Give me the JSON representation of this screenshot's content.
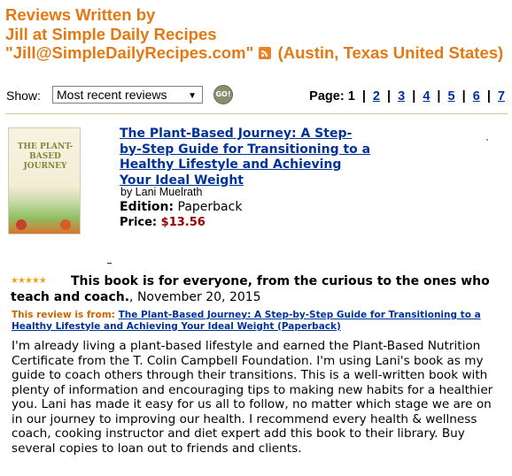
{
  "header": {
    "line1": "Reviews Written by",
    "line2": "Jill at Simple Daily Recipes",
    "email": "\"Jill@SimpleDailyRecipes.com\"",
    "rss_icon": "rss-icon",
    "location": "(Austin, Texas United States)"
  },
  "controls": {
    "show_label": "Show:",
    "sort_selected": "Most recent reviews",
    "go_label": "GO!"
  },
  "pagination": {
    "label": "Page:",
    "current": "1",
    "pages": [
      "2",
      "3",
      "4",
      "5",
      "6",
      "7"
    ],
    "separator": "|"
  },
  "product": {
    "cover_title": "THE PLANT-BASED JOURNEY",
    "title": "The Plant-Based Journey: A Step-by-Step Guide for Transitioning to a Healthy Lifestyle and Achieving Your Ideal Weight",
    "by": "by Lani Muelrath",
    "edition_label": "Edition:",
    "edition_value": "Paperback",
    "price_label": "Price:",
    "price_value": "$13.56"
  },
  "review": {
    "rating": 5,
    "rating_max": 5,
    "title": "This book is for everyone, from the curious to the ones who teach and coach.",
    "date": ", November 20, 2015",
    "from_label": "This review is from:",
    "from_link": "The Plant-Based Journey: A Step-by-Step Guide for Transitioning to a Healthy Lifestyle and Achieving Your Ideal Weight (Paperback)",
    "body": "I'm already living a plant-based lifestyle and earned the Plant-Based Nutrition Certificate from the T. Colin Campbell Foundation. I'm using Lani's book as my guide to coach others through their transitions. This is a well-written book with plenty of information and encouraging tips to making new habits for a healthier you. Lani has made it easy for us all to follow, no matter which stage we are on in our journey to improving our health. I recommend every health & wellness coach, cooking instructor and diet expert add this book to their library. Buy several copies to loan out to friends and clients."
  },
  "colors": {
    "header": "#e47911",
    "link": "#003399",
    "price": "#990000",
    "from_label": "#cc6600",
    "stars": "#f0a31a"
  }
}
